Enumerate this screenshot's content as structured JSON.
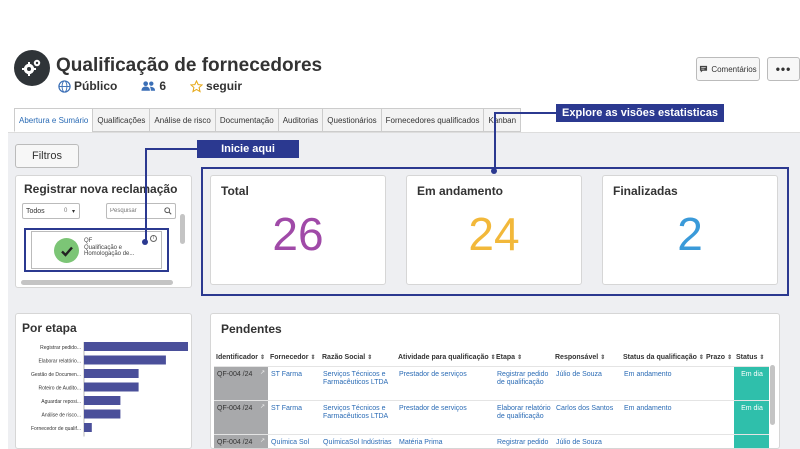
{
  "header": {
    "title": "Qualificação de fornecedores",
    "visibility": "Público",
    "members_count": "6",
    "follow_label": "seguir",
    "comments_label": "Comentários",
    "more_label": "•••",
    "icon": "gear-icon"
  },
  "tabs": [
    {
      "label": "Abertura e Sumário",
      "active": true
    },
    {
      "label": "Qualificações"
    },
    {
      "label": "Análise de risco"
    },
    {
      "label": "Documentação"
    },
    {
      "label": "Auditorias"
    },
    {
      "label": "Questionários"
    },
    {
      "label": "Fornecedores qualificados"
    },
    {
      "label": "Kanban"
    }
  ],
  "filters_button": "Filtros",
  "register": {
    "title": "Registrar nova reclamação",
    "select_value": "Todos",
    "select_count": "0",
    "search_placeholder": "Pesquisar",
    "item_code": "QF",
    "item_line1": "Qualificação e",
    "item_line2": "Homologação de..."
  },
  "metrics": {
    "total": {
      "label": "Total",
      "value": "26",
      "color": "#a04aa8"
    },
    "in_progress": {
      "label": "Em andamento",
      "value": "24",
      "color": "#f2b83a"
    },
    "finished": {
      "label": "Finalizadas",
      "value": "2",
      "color": "#3a9ad9"
    }
  },
  "chart_data": {
    "type": "bar",
    "orientation": "horizontal",
    "title": "Por etapa",
    "categories": [
      "Registrar pedido...",
      "Elaborar relatório...",
      "Gestão de Documen...",
      "Roteiro de Audito...",
      "Aguardar reposi...",
      "Análise de risco...",
      "Fornecedor de qualif..."
    ],
    "values": [
      8,
      6.3,
      4.2,
      4.2,
      2.8,
      2.8,
      0.6
    ],
    "xlim": [
      0,
      8
    ],
    "bar_color": "#4a4f9a"
  },
  "pending": {
    "title": "Pendentes",
    "columns": [
      "Identificador",
      "Fornecedor",
      "Razão Social",
      "Atividade para qualificação",
      "Etapa",
      "Responsável",
      "Status da qualificação",
      "Prazo",
      "Status"
    ],
    "rows": [
      {
        "id": "QF-004 /24",
        "supplier": "ST Farma",
        "company": "Serviços Técnicos e Farmacêuticos LTDA",
        "activity": "Prestador de serviços",
        "stage": "Registrar pedido de qualificação",
        "owner": "Júlio de Souza",
        "qual_status": "Em andamento",
        "deadline": "",
        "status": "Em dia"
      },
      {
        "id": "QF-004 /24",
        "supplier": "ST Farma",
        "company": "Serviços Técnicos e Farmacêuticos LTDA",
        "activity": "Prestador de serviços",
        "stage": "Elaborar relatório de qualificação",
        "owner": "Carlos dos Santos",
        "qual_status": "Em andamento",
        "deadline": "",
        "status": "Em dia"
      },
      {
        "id": "QF-004 /24",
        "supplier": "Química Sol",
        "company": "QuímicaSol Indústrias",
        "activity": "Matéria Prima",
        "stage": "Registrar pedido",
        "owner": "Júlio de Souza",
        "qual_status": "",
        "deadline": "",
        "status": ""
      }
    ]
  },
  "callouts": {
    "explore": "Explore as visões estatisticas",
    "start": "Inicie aqui"
  }
}
